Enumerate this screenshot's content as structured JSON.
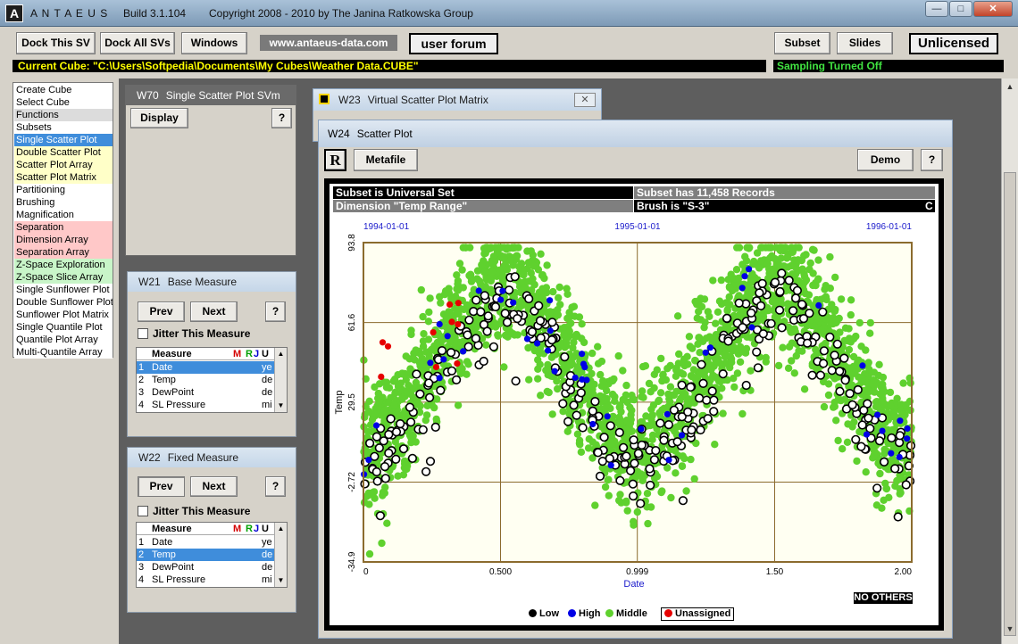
{
  "titlebar": {
    "app_name": "A N T A E U S",
    "build": "Build 3.1.104",
    "copyright": "Copyright 2008 - 2010 by The Janina Ratkowska Group",
    "app_icon": "A"
  },
  "toolbar": {
    "dock_this": "Dock This SV",
    "dock_all": "Dock All SVs",
    "windows": "Windows",
    "url": "www.antaeus-data.com",
    "forum": "user forum",
    "subset": "Subset",
    "slides": "Slides",
    "license": "Unlicensed",
    "current_cube": "Current Cube: \"C:\\Users\\Softpedia\\Documents\\My Cubes\\Weather Data.CUBE\"",
    "sampling": "Sampling Turned Off"
  },
  "menu": {
    "items": [
      {
        "label": "Create Cube",
        "color": "#ffffff"
      },
      {
        "label": "Select Cube",
        "color": "#ffffff"
      },
      {
        "label": "Functions",
        "color": "#dcdcdc"
      },
      {
        "label": "Subsets",
        "color": "#ffffff"
      },
      {
        "label": "Single Scatter Plot",
        "color": "#3f8ddb",
        "selected": true
      },
      {
        "label": "Double Scatter Plot",
        "color": "#ffffc8"
      },
      {
        "label": "Scatter Plot Array",
        "color": "#ffffc8"
      },
      {
        "label": "Scatter Plot Matrix",
        "color": "#ffffc8"
      },
      {
        "label": "Partitioning",
        "color": "#ffffff"
      },
      {
        "label": "Brushing",
        "color": "#ffffff"
      },
      {
        "label": "Magnification",
        "color": "#ffffff"
      },
      {
        "label": "Separation",
        "color": "#ffc8c8"
      },
      {
        "label": "Dimension Array",
        "color": "#ffc8c8"
      },
      {
        "label": "Separation Array",
        "color": "#ffc8c8"
      },
      {
        "label": "Z-Space Exploration",
        "color": "#c8f5c8"
      },
      {
        "label": "Z-Space Slice Array",
        "color": "#c8f5c8"
      },
      {
        "label": "Single Sunflower Plot",
        "color": "#ffffff"
      },
      {
        "label": "Double Sunflower Plot",
        "color": "#ffffff"
      },
      {
        "label": "Sunflower Plot Matrix",
        "color": "#ffffff"
      },
      {
        "label": "Single Quantile Plot",
        "color": "#ffffff"
      },
      {
        "label": "Quantile Plot Array",
        "color": "#ffffff"
      },
      {
        "label": "Multi-Quantile Array",
        "color": "#ffffff"
      }
    ]
  },
  "w70": {
    "id": "W70",
    "title": "Single Scatter Plot SVm",
    "display": "Display",
    "help": "?"
  },
  "w21": {
    "id": "W21",
    "title": "Base Measure",
    "prev": "Prev",
    "next": "Next",
    "help": "?",
    "jitter": "Jitter This Measure",
    "headers": [
      "",
      "Measure",
      "M",
      "R",
      "J",
      "U"
    ],
    "rows": [
      {
        "n": "1",
        "name": "Date",
        "u": "ye",
        "sel": true
      },
      {
        "n": "2",
        "name": "Temp",
        "u": "de",
        "sel": false
      },
      {
        "n": "3",
        "name": "DewPoint",
        "u": "de",
        "sel": false
      },
      {
        "n": "4",
        "name": "SL Pressure",
        "u": "mi",
        "sel": false
      }
    ]
  },
  "w22": {
    "id": "W22",
    "title": "Fixed Measure",
    "prev": "Prev",
    "next": "Next",
    "help": "?",
    "jitter": "Jitter This Measure",
    "headers": [
      "",
      "Measure",
      "M",
      "R",
      "J",
      "U"
    ],
    "rows": [
      {
        "n": "1",
        "name": "Date",
        "u": "ye",
        "sel": false
      },
      {
        "n": "2",
        "name": "Temp",
        "u": "de",
        "sel": true
      },
      {
        "n": "3",
        "name": "DewPoint",
        "u": "de",
        "sel": false
      },
      {
        "n": "4",
        "name": "SL Pressure",
        "u": "mi",
        "sel": false
      }
    ]
  },
  "w23": {
    "id": "W23",
    "title": "Virtual Scatter Plot Matrix"
  },
  "w24": {
    "id": "W24",
    "title": "Scatter Plot",
    "r_button": "R",
    "metafile": "Metafile",
    "demo": "Demo",
    "help": "?",
    "subset_info": "Subset is Universal Set",
    "records_info": "Subset has 11,458 Records",
    "dimension_info": "Dimension \"Temp Range\"",
    "brush_info": "Brush is \"S-3\"",
    "brush_flag": "C",
    "no_others": "NO OTHERS"
  },
  "chart_data": {
    "type": "scatter",
    "title": "",
    "xlabel": "Date",
    "ylabel": "Temp",
    "xlim": [
      0,
      2.0
    ],
    "ylim": [
      -34.9,
      93.8
    ],
    "x_ticks": [
      "0",
      "0.500",
      "0.999",
      "1.50",
      "2.00"
    ],
    "y_ticks": [
      "93.8",
      "61.6",
      "29.5",
      "-2.72",
      "-34.9"
    ],
    "date_ticks": [
      "1994-01-01",
      "1995-01-01",
      "1996-01-01"
    ],
    "grid": true,
    "legend": [
      {
        "name": "Low",
        "color": "#000000"
      },
      {
        "name": "High",
        "color": "#0000e6"
      },
      {
        "name": "Middle",
        "color": "#5fd12e"
      },
      {
        "name": "Unassigned",
        "color": "#e60000"
      }
    ],
    "colors": {
      "middle": "#5fd12e",
      "low": "#000000",
      "high": "#0000e6",
      "unassigned": "#e60000",
      "plot_bg": "#fffff2",
      "grid": "#8b6b2e"
    },
    "pattern": {
      "mean_peak": 75,
      "mean_trough": 12,
      "spread": 23,
      "peak_at": [
        0.5,
        1.5
      ]
    },
    "counts": {
      "middle": 2400,
      "low": 330,
      "high": 48,
      "unassigned": 10
    }
  }
}
